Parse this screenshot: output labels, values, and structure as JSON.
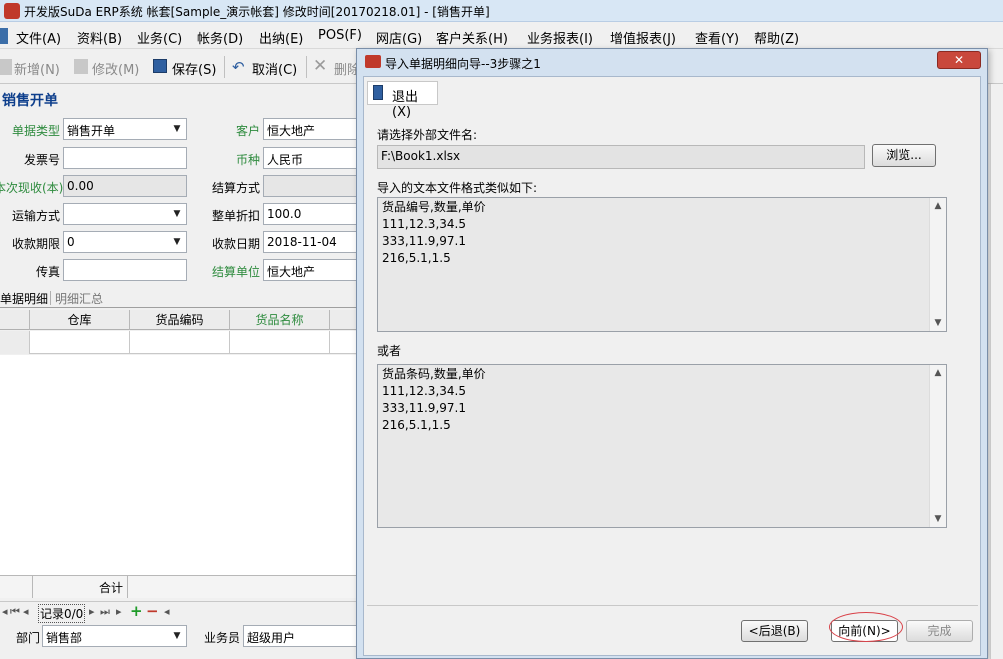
{
  "window": {
    "title": "开发版SuDa ERP系统  帐套[Sample_演示帐套] 修改时间[20170218.01] - [销售开单]"
  },
  "menu": [
    "文件(A)",
    "资料(B)",
    "业务(C)",
    "帐务(D)",
    "出纳(E)",
    "POS(F)",
    "网店(G)",
    "客户关系(H)",
    "业务报表(I)",
    "增值报表(J)",
    "查看(Y)",
    "帮助(Z)"
  ],
  "toolbar": {
    "new": "新增(N)",
    "edit": "修改(M)",
    "save": "保存(S)",
    "cancel": "取消(C)",
    "delete": "删除"
  },
  "form": {
    "title": "销售开单",
    "doc_type_label": "单据类型",
    "doc_type_value": "销售开单",
    "customer_label": "客户",
    "customer_value": "恒大地产",
    "invoice_label": "发票号",
    "invoice_value": "",
    "currency_label": "币种",
    "currency_value": "人民币",
    "received_label": "本次现收(本)",
    "received_value": "0.00",
    "settle_label": "结算方式",
    "settle_value": "",
    "transport_label": "运输方式",
    "transport_value": "",
    "discount_label": "整单折扣",
    "discount_value": "100.0",
    "term_label": "收款期限",
    "term_value": "0",
    "date_label": "收款日期",
    "date_value": "2018-11-04",
    "fax_label": "传真",
    "fax_value": "",
    "unit_label": "结算单位",
    "unit_value": "恒大地产"
  },
  "tabs": [
    "单据明细",
    "明细汇总"
  ],
  "grid": {
    "columns": [
      "仓库",
      "货品编码",
      "货品名称"
    ],
    "sum_label": "合计"
  },
  "nav": {
    "record": "记录0/0"
  },
  "footer": {
    "dept_label": "部门",
    "dept_value": "销售部",
    "clerk_label": "业务员",
    "clerk_value": "超级用户"
  },
  "dialog": {
    "title": "导入单据明细向导--3步骤之1",
    "exit_label": "退出(X)",
    "choose_label": "请选择外部文件名:",
    "file_value": "F:\\Book1.xlsx",
    "browse_label": "浏览...",
    "format_label": "导入的文本文件格式类似如下:",
    "sample1": [
      "货品编号,数量,单价",
      "111,12.3,34.5",
      "333,11.9,97.1",
      "216,5.1,1.5"
    ],
    "or_label": "或者",
    "sample2": [
      "货品条码,数量,单价",
      "111,12.3,34.5",
      "333,11.9,97.1",
      "216,5.1,1.5"
    ],
    "back_label": "<后退(B)",
    "next_label": "向前(N)>",
    "finish_label": "完成"
  },
  "colors": {
    "green_label": "#2e8b3e",
    "title_blue": "#0e3f8c",
    "highlight": "#d9434a"
  }
}
